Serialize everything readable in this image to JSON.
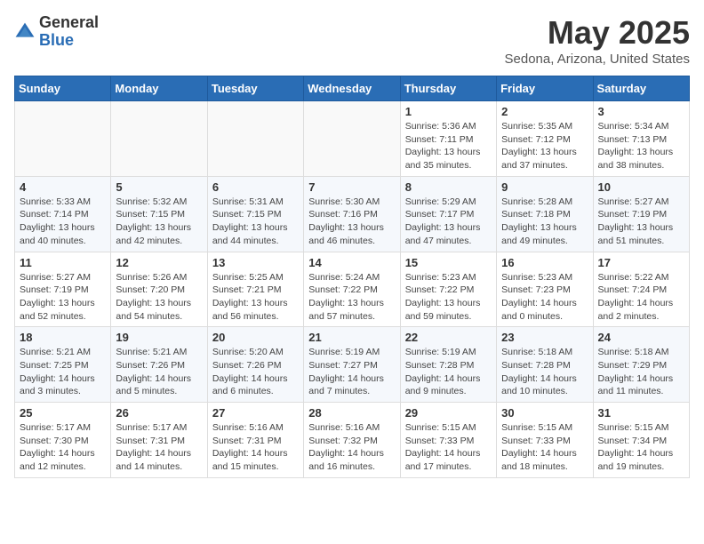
{
  "header": {
    "logo_general": "General",
    "logo_blue": "Blue",
    "month_title": "May 2025",
    "location": "Sedona, Arizona, United States"
  },
  "weekdays": [
    "Sunday",
    "Monday",
    "Tuesday",
    "Wednesday",
    "Thursday",
    "Friday",
    "Saturday"
  ],
  "weeks": [
    [
      {
        "day": "",
        "empty": true
      },
      {
        "day": "",
        "empty": true
      },
      {
        "day": "",
        "empty": true
      },
      {
        "day": "",
        "empty": true
      },
      {
        "day": "1",
        "sunrise": "5:36 AM",
        "sunset": "7:11 PM",
        "daylight": "13 hours and 35 minutes."
      },
      {
        "day": "2",
        "sunrise": "5:35 AM",
        "sunset": "7:12 PM",
        "daylight": "13 hours and 37 minutes."
      },
      {
        "day": "3",
        "sunrise": "5:34 AM",
        "sunset": "7:13 PM",
        "daylight": "13 hours and 38 minutes."
      }
    ],
    [
      {
        "day": "4",
        "sunrise": "5:33 AM",
        "sunset": "7:14 PM",
        "daylight": "13 hours and 40 minutes."
      },
      {
        "day": "5",
        "sunrise": "5:32 AM",
        "sunset": "7:15 PM",
        "daylight": "13 hours and 42 minutes."
      },
      {
        "day": "6",
        "sunrise": "5:31 AM",
        "sunset": "7:15 PM",
        "daylight": "13 hours and 44 minutes."
      },
      {
        "day": "7",
        "sunrise": "5:30 AM",
        "sunset": "7:16 PM",
        "daylight": "13 hours and 46 minutes."
      },
      {
        "day": "8",
        "sunrise": "5:29 AM",
        "sunset": "7:17 PM",
        "daylight": "13 hours and 47 minutes."
      },
      {
        "day": "9",
        "sunrise": "5:28 AM",
        "sunset": "7:18 PM",
        "daylight": "13 hours and 49 minutes."
      },
      {
        "day": "10",
        "sunrise": "5:27 AM",
        "sunset": "7:19 PM",
        "daylight": "13 hours and 51 minutes."
      }
    ],
    [
      {
        "day": "11",
        "sunrise": "5:27 AM",
        "sunset": "7:19 PM",
        "daylight": "13 hours and 52 minutes."
      },
      {
        "day": "12",
        "sunrise": "5:26 AM",
        "sunset": "7:20 PM",
        "daylight": "13 hours and 54 minutes."
      },
      {
        "day": "13",
        "sunrise": "5:25 AM",
        "sunset": "7:21 PM",
        "daylight": "13 hours and 56 minutes."
      },
      {
        "day": "14",
        "sunrise": "5:24 AM",
        "sunset": "7:22 PM",
        "daylight": "13 hours and 57 minutes."
      },
      {
        "day": "15",
        "sunrise": "5:23 AM",
        "sunset": "7:22 PM",
        "daylight": "13 hours and 59 minutes."
      },
      {
        "day": "16",
        "sunrise": "5:23 AM",
        "sunset": "7:23 PM",
        "daylight": "14 hours and 0 minutes."
      },
      {
        "day": "17",
        "sunrise": "5:22 AM",
        "sunset": "7:24 PM",
        "daylight": "14 hours and 2 minutes."
      }
    ],
    [
      {
        "day": "18",
        "sunrise": "5:21 AM",
        "sunset": "7:25 PM",
        "daylight": "14 hours and 3 minutes."
      },
      {
        "day": "19",
        "sunrise": "5:21 AM",
        "sunset": "7:26 PM",
        "daylight": "14 hours and 5 minutes."
      },
      {
        "day": "20",
        "sunrise": "5:20 AM",
        "sunset": "7:26 PM",
        "daylight": "14 hours and 6 minutes."
      },
      {
        "day": "21",
        "sunrise": "5:19 AM",
        "sunset": "7:27 PM",
        "daylight": "14 hours and 7 minutes."
      },
      {
        "day": "22",
        "sunrise": "5:19 AM",
        "sunset": "7:28 PM",
        "daylight": "14 hours and 9 minutes."
      },
      {
        "day": "23",
        "sunrise": "5:18 AM",
        "sunset": "7:28 PM",
        "daylight": "14 hours and 10 minutes."
      },
      {
        "day": "24",
        "sunrise": "5:18 AM",
        "sunset": "7:29 PM",
        "daylight": "14 hours and 11 minutes."
      }
    ],
    [
      {
        "day": "25",
        "sunrise": "5:17 AM",
        "sunset": "7:30 PM",
        "daylight": "14 hours and 12 minutes."
      },
      {
        "day": "26",
        "sunrise": "5:17 AM",
        "sunset": "7:31 PM",
        "daylight": "14 hours and 14 minutes."
      },
      {
        "day": "27",
        "sunrise": "5:16 AM",
        "sunset": "7:31 PM",
        "daylight": "14 hours and 15 minutes."
      },
      {
        "day": "28",
        "sunrise": "5:16 AM",
        "sunset": "7:32 PM",
        "daylight": "14 hours and 16 minutes."
      },
      {
        "day": "29",
        "sunrise": "5:15 AM",
        "sunset": "7:33 PM",
        "daylight": "14 hours and 17 minutes."
      },
      {
        "day": "30",
        "sunrise": "5:15 AM",
        "sunset": "7:33 PM",
        "daylight": "14 hours and 18 minutes."
      },
      {
        "day": "31",
        "sunrise": "5:15 AM",
        "sunset": "7:34 PM",
        "daylight": "14 hours and 19 minutes."
      }
    ]
  ],
  "labels": {
    "sunrise": "Sunrise:",
    "sunset": "Sunset:",
    "daylight": "Daylight:"
  }
}
